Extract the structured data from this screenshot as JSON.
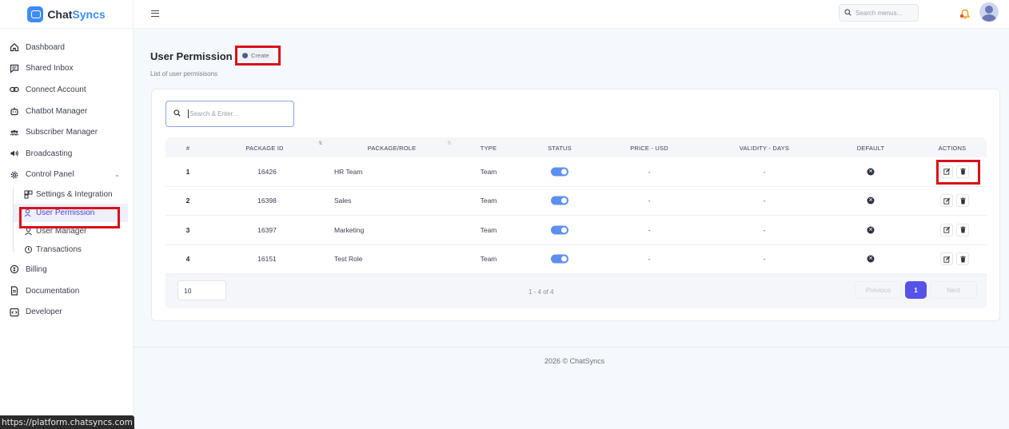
{
  "app": {
    "brand_prefix": "Chat",
    "brand_suffix": "Syncs",
    "brand_color": "#3f8cf5",
    "accent_color": "#5652e8",
    "highlight_color": "#d90f1a"
  },
  "topbar": {
    "search_placeholder": "Search menus...",
    "bell_icon": "bell-icon",
    "avatar_icon": "user-avatar"
  },
  "sidebar": {
    "items": [
      {
        "label": "Dashboard",
        "icon": "home-icon"
      },
      {
        "label": "Shared Inbox",
        "icon": "chat-icon"
      },
      {
        "label": "Connect Account",
        "icon": "link-icon"
      },
      {
        "label": "Chatbot Manager",
        "icon": "robot-icon"
      },
      {
        "label": "Subscriber Manager",
        "icon": "users-icon"
      },
      {
        "label": "Broadcasting",
        "icon": "speaker-icon"
      },
      {
        "label": "Control Panel",
        "icon": "settings-icon",
        "expanded": true
      }
    ],
    "sub_items": [
      {
        "label": "Settings & Integration",
        "icon": "grid-icon"
      },
      {
        "label": "User Permission",
        "icon": "user-key-icon",
        "active": true
      },
      {
        "label": "User Manager",
        "icon": "user-icon"
      },
      {
        "label": "Transactions",
        "icon": "clock-icon"
      }
    ],
    "bottom_items": [
      {
        "label": "Billing",
        "icon": "billing-icon"
      },
      {
        "label": "Documentation",
        "icon": "document-icon"
      },
      {
        "label": "Developer",
        "icon": "code-icon"
      }
    ]
  },
  "page": {
    "title": "User Permission",
    "create_label": "Create",
    "subtitle": "List of user permisisons"
  },
  "table": {
    "search_placeholder": "Search & Enter...",
    "columns": [
      "#",
      "PACKAGE ID",
      "PACKAGE/ROLE",
      "TYPE",
      "STATUS",
      "PRICE - USD",
      "VALIDITY - DAYS",
      "DEFAULT",
      "ACTIONS"
    ],
    "rows": [
      {
        "num": "1",
        "package_id": "16426",
        "role": "HR Team",
        "type": "Team",
        "status": true,
        "price": "-",
        "validity": "-"
      },
      {
        "num": "2",
        "package_id": "16398",
        "role": "Sales",
        "type": "Team",
        "status": true,
        "price": "-",
        "validity": "-"
      },
      {
        "num": "3",
        "package_id": "16397",
        "role": "Marketing",
        "type": "Team",
        "status": true,
        "price": "-",
        "validity": "-"
      },
      {
        "num": "4",
        "package_id": "16151",
        "role": "Test Role",
        "type": "Team",
        "status": true,
        "price": "-",
        "validity": "-"
      }
    ],
    "page_size": "10",
    "range": "1 - 4 of 4",
    "prev_label": "Previous",
    "current_page": "1",
    "next_label": "Next"
  },
  "footer": {
    "copyright": "2026 © ChatSyncs"
  },
  "status_bar": {
    "url": "https://platform.chatsyncs.com"
  }
}
